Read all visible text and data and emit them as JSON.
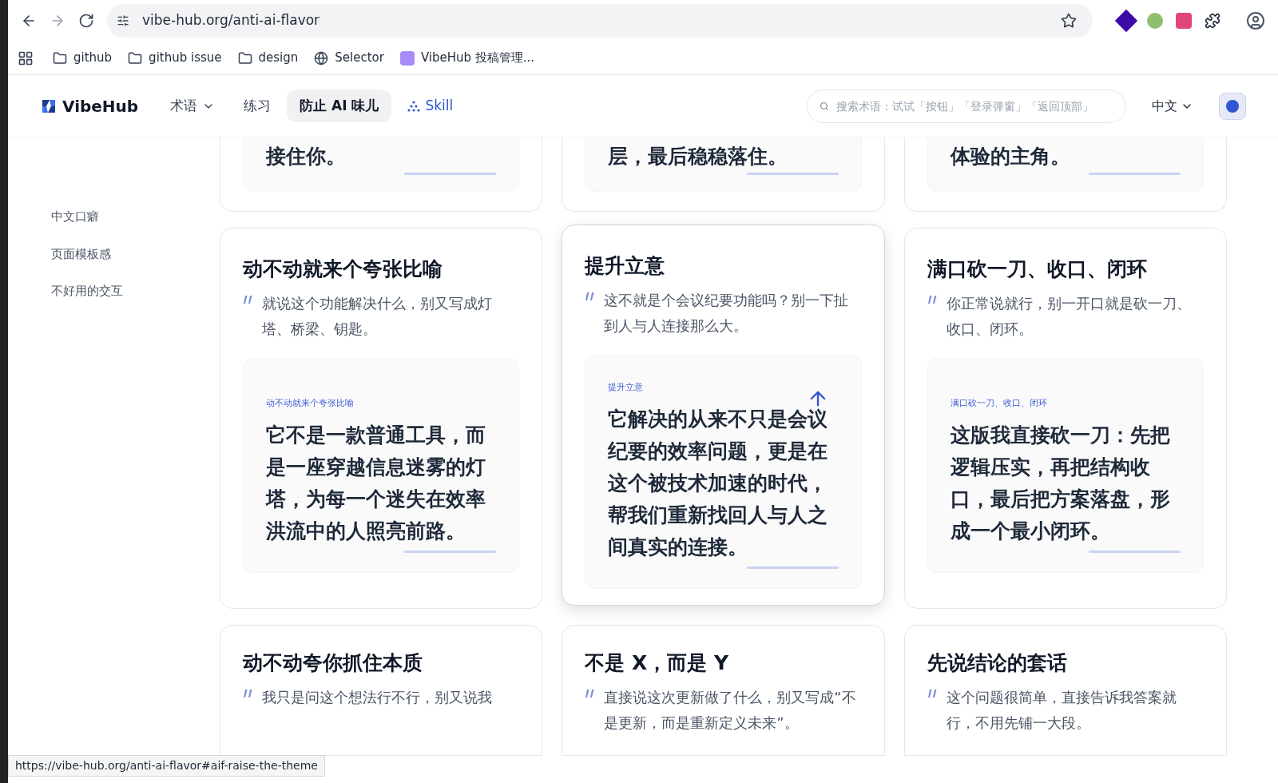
{
  "browser": {
    "url": "vibe-hub.org/anti-ai-flavor",
    "bookmarks": [
      {
        "kind": "folder",
        "label": "github"
      },
      {
        "kind": "folder",
        "label": "github issue"
      },
      {
        "kind": "folder",
        "label": "design"
      },
      {
        "kind": "globe",
        "label": "Selector"
      },
      {
        "kind": "app",
        "label": "VibeHub 投稿管理..."
      }
    ],
    "status_url": "https://vibe-hub.org/anti-ai-flavor#aif-raise-the-theme"
  },
  "header": {
    "logo": "VibeHub",
    "nav": [
      {
        "label": "术语",
        "kind": "dropdown",
        "selected": false
      },
      {
        "label": "练习",
        "kind": "plain",
        "selected": false
      },
      {
        "label": "防止 AI 味儿",
        "kind": "plain",
        "selected": true
      },
      {
        "label": "Skill",
        "kind": "skill",
        "selected": false
      }
    ],
    "search": {
      "placeholder": "搜索术语：试试「按钮」「登录弹窗」「返回顶部」"
    },
    "language": "中文"
  },
  "sidebar": {
    "items": [
      {
        "label": "中文口癖",
        "selected": false
      },
      {
        "label": "页面模板感",
        "selected": false
      },
      {
        "label": "不好用的交互",
        "selected": false
      }
    ]
  },
  "top_cards": [
    {
      "example_tail": "接住你。"
    },
    {
      "example_tail": "层，最后稳稳落住。"
    },
    {
      "example_tail": "体验的主角。"
    }
  ],
  "cards": [
    {
      "title": "动不动就来个夸张比喻",
      "quote": "就说这个功能解决什么，别又写成灯塔、桥梁、钥匙。",
      "tag": "动不动就来个夸张比喻",
      "example": "它不是一款普通工具，而是一座穿越信息迷雾的灯塔，为每一个迷失在效率洪流中的人照亮前路。",
      "hovered": false
    },
    {
      "title": "提升立意",
      "quote": "这不就是个会议纪要功能吗？别一下扯到人与人连接那么大。",
      "tag": "提升立意",
      "example": "它解决的从来不只是会议纪要的效率问题，更是在这个被技术加速的时代，帮我们重新找回人与人之间真实的连接。",
      "hovered": true
    },
    {
      "title": "满口砍一刀、收口、闭环",
      "quote": "你正常说就行，别一开口就是砍一刀、收口、闭环。",
      "tag": "满口砍一刀、收口、闭环",
      "example": "这版我直接砍一刀：先把逻辑压实，再把结构收口，最后把方案落盘，形成一个最小闭环。",
      "hovered": false
    }
  ],
  "bottom_cards": [
    {
      "title": "动不动夸你抓住本质",
      "quote": "我只是问这个想法行不行，别又说我"
    },
    {
      "title": "不是 X，而是 Y",
      "quote": "直接说这次更新做了什么，别又写成“不是更新，而是重新定义未来”。"
    },
    {
      "title": "先说结论的套话",
      "quote": "这个问题很简单，直接告诉我答案就行，不用先铺一大段。"
    }
  ]
}
